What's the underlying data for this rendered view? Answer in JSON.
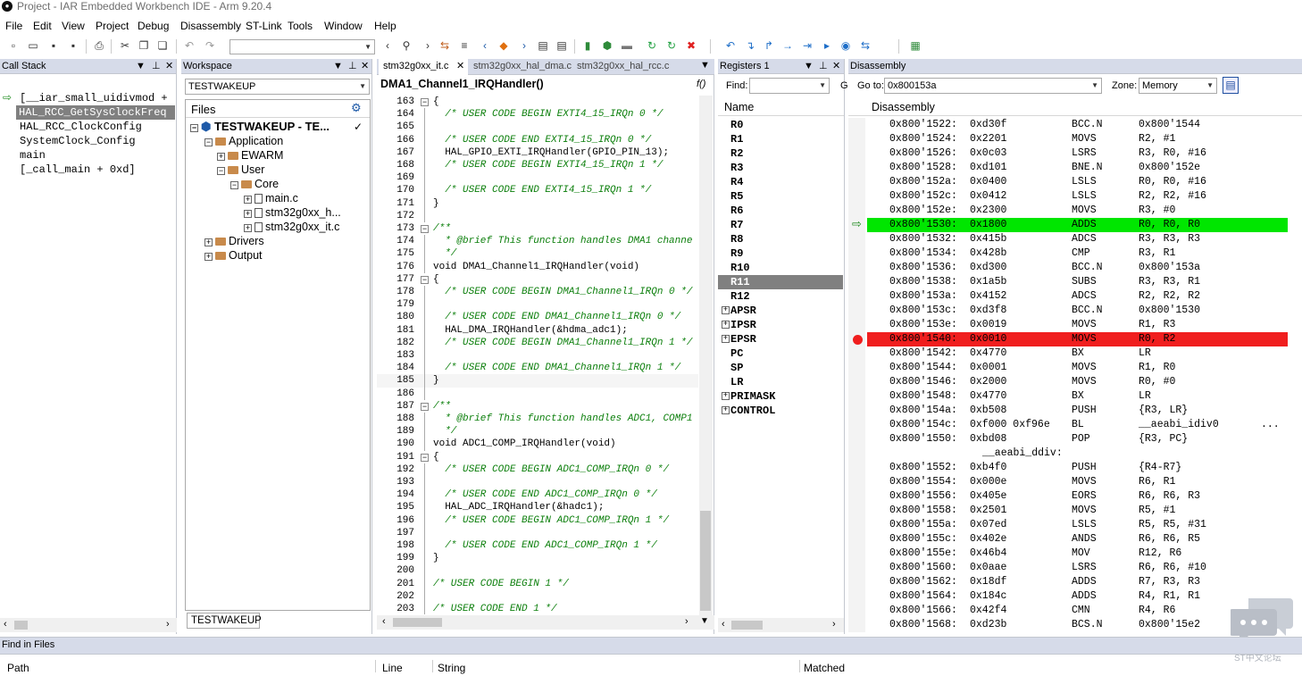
{
  "window": {
    "title": "Project - IAR Embedded Workbench IDE - Arm 9.20.4"
  },
  "menu": [
    "File",
    "Edit",
    "View",
    "Project",
    "Debug",
    "Disassembly",
    "ST-Link",
    "Tools",
    "Window",
    "Help"
  ],
  "call_stack": {
    "title": "Call Stack",
    "items": [
      "[__iar_small_uidivmod +",
      "HAL_RCC_GetSysClockFreq",
      "HAL_RCC_ClockConfig",
      "SystemClock_Config",
      "main",
      "[_call_main + 0xd]"
    ]
  },
  "workspace": {
    "title": "Workspace",
    "selector": "TESTWAKEUP",
    "files_header": "Files",
    "tab": "TESTWAKEUP",
    "tree": [
      "TESTWAKEUP - TE...",
      "Application",
      "EWARM",
      "User",
      "Core",
      "main.c",
      "stm32g0xx_h...",
      "stm32g0xx_it.c",
      "Drivers",
      "Output"
    ]
  },
  "editor": {
    "tabs": [
      "stm32g0xx_it.c",
      "stm32g0xx_hal_dma.c",
      "stm32g0xx_hal_rcc.c"
    ],
    "function": "DMA1_Channel1_IRQHandler()",
    "func_btn": "f()",
    "lines": [
      {
        "n": "163",
        "t": "{"
      },
      {
        "n": "164",
        "t": "  /* USER CODE BEGIN EXTI4_15_IRQn 0 */",
        "c": 1
      },
      {
        "n": "165",
        "t": ""
      },
      {
        "n": "166",
        "t": "  /* USER CODE END EXTI4_15_IRQn 0 */",
        "c": 1
      },
      {
        "n": "167",
        "t": "  HAL_GPIO_EXTI_IRQHandler(GPIO_PIN_13);"
      },
      {
        "n": "168",
        "t": "  /* USER CODE BEGIN EXTI4_15_IRQn 1 */",
        "c": 1
      },
      {
        "n": "169",
        "t": ""
      },
      {
        "n": "170",
        "t": "  /* USER CODE END EXTI4_15_IRQn 1 */",
        "c": 1
      },
      {
        "n": "171",
        "t": "}"
      },
      {
        "n": "172",
        "t": ""
      },
      {
        "n": "173",
        "t": "/**",
        "c": 1
      },
      {
        "n": "174",
        "t": "  * @brief This function handles DMA1 channe",
        "c": 1
      },
      {
        "n": "175",
        "t": "  */",
        "c": 1
      },
      {
        "n": "176",
        "t": "void DMA1_Channel1_IRQHandler(void)"
      },
      {
        "n": "177",
        "t": "{"
      },
      {
        "n": "178",
        "t": "  /* USER CODE BEGIN DMA1_Channel1_IRQn 0 */",
        "c": 1
      },
      {
        "n": "179",
        "t": ""
      },
      {
        "n": "180",
        "t": "  /* USER CODE END DMA1_Channel1_IRQn 0 */",
        "c": 1
      },
      {
        "n": "181",
        "t": "  HAL_DMA_IRQHandler(&hdma_adc1);"
      },
      {
        "n": "182",
        "t": "  /* USER CODE BEGIN DMA1_Channel1_IRQn 1 */",
        "c": 1
      },
      {
        "n": "183",
        "t": ""
      },
      {
        "n": "184",
        "t": "  /* USER CODE END DMA1_Channel1_IRQn 1 */",
        "c": 1
      },
      {
        "n": "185",
        "t": "}"
      },
      {
        "n": "186",
        "t": ""
      },
      {
        "n": "187",
        "t": "/**",
        "c": 1
      },
      {
        "n": "188",
        "t": "  * @brief This function handles ADC1, COMP1",
        "c": 1
      },
      {
        "n": "189",
        "t": "  */",
        "c": 1
      },
      {
        "n": "190",
        "t": "void ADC1_COMP_IRQHandler(void)"
      },
      {
        "n": "191",
        "t": "{"
      },
      {
        "n": "192",
        "t": "  /* USER CODE BEGIN ADC1_COMP_IRQn 0 */",
        "c": 1
      },
      {
        "n": "193",
        "t": ""
      },
      {
        "n": "194",
        "t": "  /* USER CODE END ADC1_COMP_IRQn 0 */",
        "c": 1
      },
      {
        "n": "195",
        "t": "  HAL_ADC_IRQHandler(&hadc1);"
      },
      {
        "n": "196",
        "t": "  /* USER CODE BEGIN ADC1_COMP_IRQn 1 */",
        "c": 1
      },
      {
        "n": "197",
        "t": ""
      },
      {
        "n": "198",
        "t": "  /* USER CODE END ADC1_COMP_IRQn 1 */",
        "c": 1
      },
      {
        "n": "199",
        "t": "}"
      },
      {
        "n": "200",
        "t": ""
      },
      {
        "n": "201",
        "t": "/* USER CODE BEGIN 1 */",
        "c": 1
      },
      {
        "n": "202",
        "t": ""
      },
      {
        "n": "203",
        "t": "/* USER CODE END 1 */",
        "c": 1
      }
    ]
  },
  "registers": {
    "title": "Registers 1",
    "find_label": "Find:",
    "col_name": "Name",
    "rows": [
      "R0",
      "R1",
      "R2",
      "R3",
      "R4",
      "R5",
      "R6",
      "R7",
      "R8",
      "R9",
      "R10",
      "R11",
      "R12",
      "APSR",
      "IPSR",
      "EPSR",
      "PC",
      "SP",
      "LR",
      "PRIMASK",
      "CONTROL"
    ]
  },
  "disassembly": {
    "title": "Disassembly",
    "goto_label": "Go to:",
    "goto_value": "0x800153a",
    "zone_label": "Zone:",
    "zone_value": "Memory",
    "col": "Disassembly",
    "c_label": "G",
    "rows": [
      [
        "0x800'1522:",
        "0xd30f",
        "BCC.N",
        "0x800'1544"
      ],
      [
        "0x800'1524:",
        "0x2201",
        "MOVS",
        "R2, #1"
      ],
      [
        "0x800'1526:",
        "0x0c03",
        "LSRS",
        "R3, R0, #16"
      ],
      [
        "0x800'1528:",
        "0xd101",
        "BNE.N",
        "0x800'152e"
      ],
      [
        "0x800'152a:",
        "0x0400",
        "LSLS",
        "R0, R0, #16"
      ],
      [
        "0x800'152c:",
        "0x0412",
        "LSLS",
        "R2, R2, #16"
      ],
      [
        "0x800'152e:",
        "0x2300",
        "MOVS",
        "R3, #0"
      ],
      [
        "0x800'1530:",
        "0x1800",
        "ADDS",
        "R0, R0, R0"
      ],
      [
        "0x800'1532:",
        "0x415b",
        "ADCS",
        "R3, R3, R3"
      ],
      [
        "0x800'1534:",
        "0x428b",
        "CMP",
        "R3, R1"
      ],
      [
        "0x800'1536:",
        "0xd300",
        "BCC.N",
        "0x800'153a"
      ],
      [
        "0x800'1538:",
        "0x1a5b",
        "SUBS",
        "R3, R3, R1"
      ],
      [
        "0x800'153a:",
        "0x4152",
        "ADCS",
        "R2, R2, R2"
      ],
      [
        "0x800'153c:",
        "0xd3f8",
        "BCC.N",
        "0x800'1530"
      ],
      [
        "0x800'153e:",
        "0x0019",
        "MOVS",
        "R1, R3"
      ],
      [
        "0x800'1540:",
        "0x0010",
        "MOVS",
        "R0, R2"
      ],
      [
        "0x800'1542:",
        "0x4770",
        "BX",
        "LR"
      ],
      [
        "0x800'1544:",
        "0x0001",
        "MOVS",
        "R1, R0"
      ],
      [
        "0x800'1546:",
        "0x2000",
        "MOVS",
        "R0, #0"
      ],
      [
        "0x800'1548:",
        "0x4770",
        "BX",
        "LR"
      ],
      [
        "0x800'154a:",
        "0xb508",
        "PUSH",
        "{R3, LR}"
      ],
      [
        "0x800'154c:",
        "0xf000 0xf96e",
        "BL",
        "__aeabi_idiv0"
      ],
      [
        "0x800'1550:",
        "0xbd08",
        "POP",
        "{R3, PC}"
      ],
      [
        "",
        "",
        "__aeabi_ddiv:",
        ""
      ],
      [
        "0x800'1552:",
        "0xb4f0",
        "PUSH",
        "{R4-R7}"
      ],
      [
        "0x800'1554:",
        "0x000e",
        "MOVS",
        "R6, R1"
      ],
      [
        "0x800'1556:",
        "0x405e",
        "EORS",
        "R6, R6, R3"
      ],
      [
        "0x800'1558:",
        "0x2501",
        "MOVS",
        "R5, #1"
      ],
      [
        "0x800'155a:",
        "0x07ed",
        "LSLS",
        "R5, R5, #31"
      ],
      [
        "0x800'155c:",
        "0x402e",
        "ANDS",
        "R6, R6, R5"
      ],
      [
        "0x800'155e:",
        "0x46b4",
        "MOV",
        "R12, R6"
      ],
      [
        "0x800'1560:",
        "0x0aae",
        "LSRS",
        "R6, R6, #10"
      ],
      [
        "0x800'1562:",
        "0x18df",
        "ADDS",
        "R7, R3, R3"
      ],
      [
        "0x800'1564:",
        "0x184c",
        "ADDS",
        "R4, R1, R1"
      ],
      [
        "0x800'1566:",
        "0x42f4",
        "CMN",
        "R4, R6"
      ],
      [
        "0x800'1568:",
        "0xd23b",
        "BCS.N",
        "0x800'15e2"
      ]
    ],
    "ellipsis": "...",
    "current_row": 7,
    "break_row": 15
  },
  "find_in_files": {
    "title": "Find in Files",
    "cols": [
      "Path",
      "Line",
      "String",
      "Matched"
    ]
  },
  "watermark": "ST中文论坛",
  "colors": {
    "current": "#00e600",
    "breakpoint": "#f01e1e",
    "selected_reg": "#808080",
    "header": "#d6dbe9"
  }
}
